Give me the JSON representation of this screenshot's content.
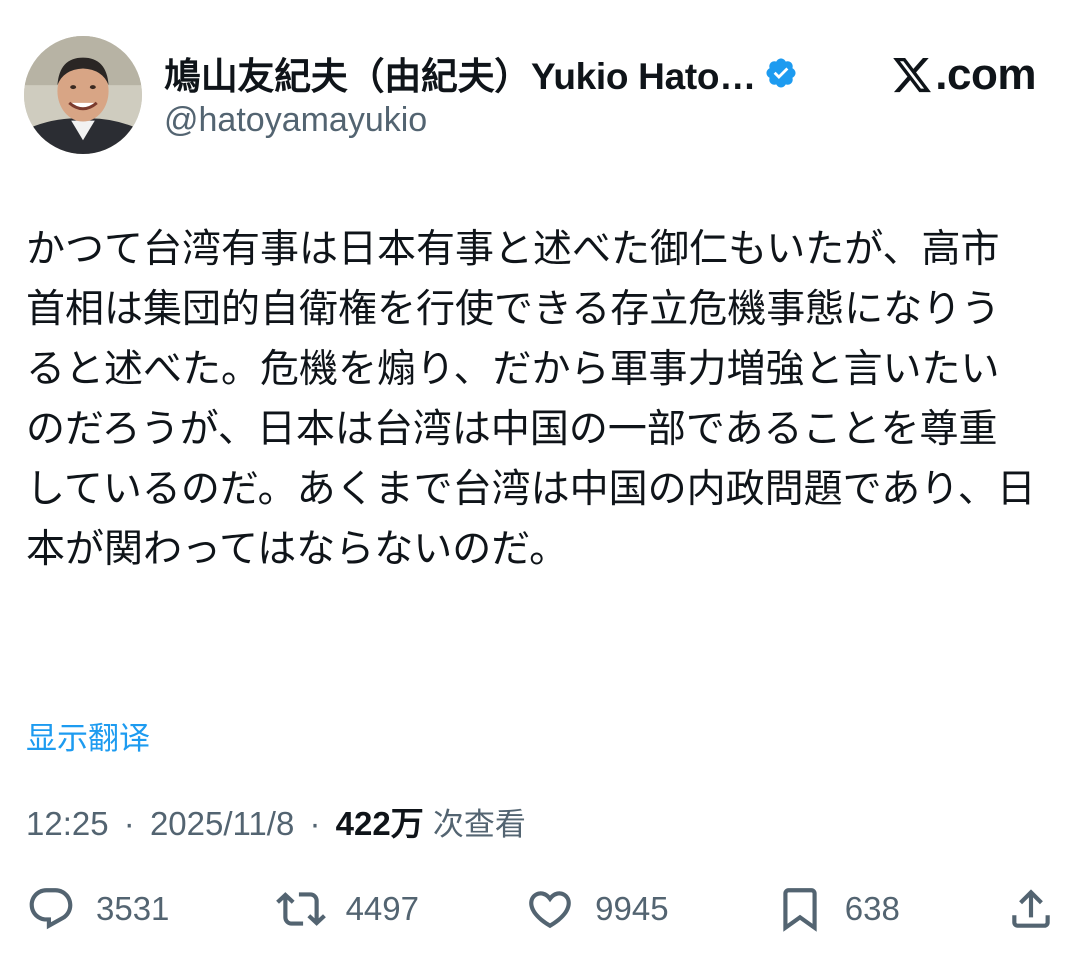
{
  "user": {
    "display_name": "鳩山友紀夫（由紀夫）Yukio Hato…",
    "handle": "@hatoyamayukio",
    "verified": true,
    "avatar": "profile-photo"
  },
  "brand": {
    "logo_icon": "x-logo-icon",
    "domain_suffix": ".com"
  },
  "tweet": {
    "text": "かつて台湾有事は日本有事と述べた御仁もいたが、高市首相は集団的自衛権を行使できる存立危機事態になりうると述べた。危機を煽り、だから軍事力増強と言いたいのだろうが、日本は台湾は中国の一部であることを尊重しているのだ。あくまで台湾は中国の内政問題であり、日本が関わってはならないのだ。",
    "translate_label": "显示翻译"
  },
  "meta": {
    "time": "12:25",
    "separator": "·",
    "date": "2025/11/8",
    "views": "422万",
    "views_label": "次查看"
  },
  "actions": {
    "replies": "3531",
    "reposts": "4497",
    "likes": "9945",
    "bookmarks": "638"
  },
  "colors": {
    "accent": "#1d9bf0",
    "text": "#0f1419",
    "secondary": "#536471",
    "verified": "#1d9bf0"
  }
}
